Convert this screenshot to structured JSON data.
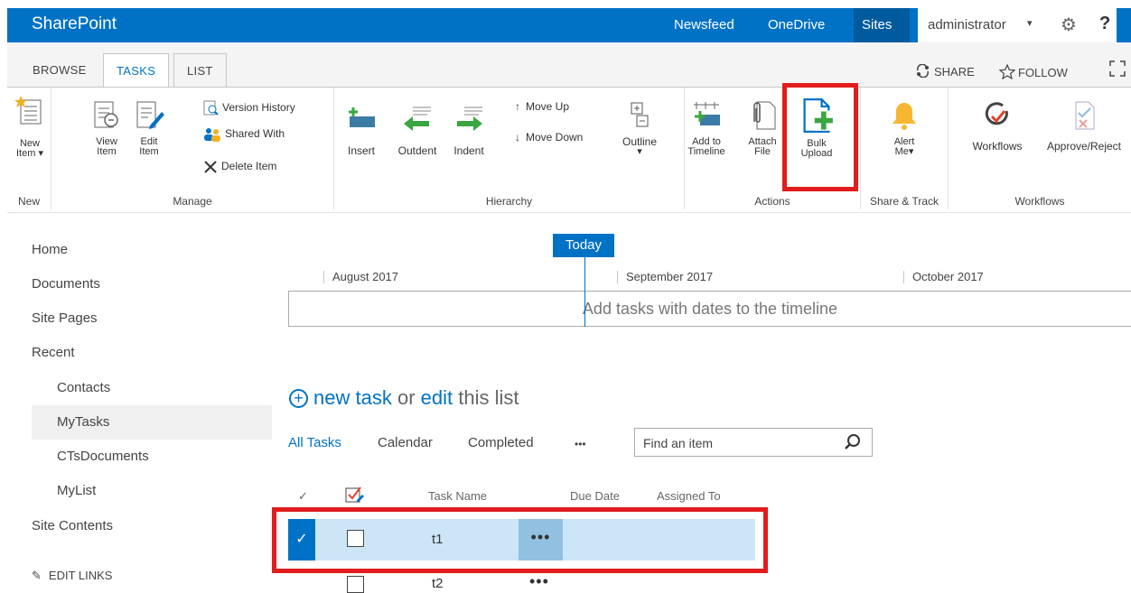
{
  "suite_bar": {
    "brand": "SharePoint",
    "links": [
      "Newsfeed",
      "OneDrive",
      "Sites"
    ],
    "user": "administrator",
    "accent": "#0072c6"
  },
  "ribbon_tabs": {
    "browse": "BROWSE",
    "tasks": "TASKS",
    "list": "LIST",
    "share": "SHARE",
    "follow": "FOLLOW"
  },
  "ribbon": {
    "new_group": {
      "label": "New",
      "new_item_line1": "New",
      "new_item_line2": "Item"
    },
    "manage_group": {
      "label": "Manage",
      "view_item_line1": "View",
      "view_item_line2": "Item",
      "edit_item_line1": "Edit",
      "edit_item_line2": "Item",
      "version_history": "Version History",
      "shared_with": "Shared With",
      "delete_item": "Delete Item"
    },
    "hierarchy_group": {
      "label": "Hierarchy",
      "insert": "Insert",
      "outdent": "Outdent",
      "indent": "Indent",
      "move_up": "Move Up",
      "move_down": "Move Down",
      "outline": "Outline"
    },
    "actions_group": {
      "label": "Actions",
      "add_timeline_line1": "Add to",
      "add_timeline_line2": "Timeline",
      "attach_file_line1": "Attach",
      "attach_file_line2": "File",
      "bulk_upload_line1": "Bulk",
      "bulk_upload_line2": "Upload"
    },
    "share_group": {
      "label": "Share & Track",
      "alert_line1": "Alert",
      "alert_line2": "Me"
    },
    "workflows_group": {
      "label": "Workflows",
      "workflows": "Workflows",
      "approve_reject": "Approve/Reject"
    }
  },
  "left_nav": {
    "home": "Home",
    "documents": "Documents",
    "site_pages": "Site Pages",
    "recent": "Recent",
    "contacts": "Contacts",
    "mytasks": "MyTasks",
    "ctsdocuments": "CTsDocuments",
    "mylist": "MyList",
    "site_contents": "Site Contents",
    "edit_links": "EDIT LINKS"
  },
  "timeline": {
    "today": "Today",
    "months": [
      "August 2017",
      "September 2017",
      "October 2017"
    ],
    "empty_message": "Add tasks with dates to the timeline"
  },
  "list": {
    "new_task": "new task",
    "or": "or",
    "edit": "edit",
    "this_list": "this list",
    "views": [
      "All Tasks",
      "Calendar",
      "Completed"
    ],
    "more": "•••",
    "search_placeholder": "Find an item",
    "columns": {
      "task_name": "Task Name",
      "due_date": "Due Date",
      "assigned_to": "Assigned To"
    },
    "rows": [
      {
        "name": "t1",
        "selected": true
      },
      {
        "name": "t2",
        "selected": false
      }
    ]
  },
  "highlight_color": "#e11d1d"
}
